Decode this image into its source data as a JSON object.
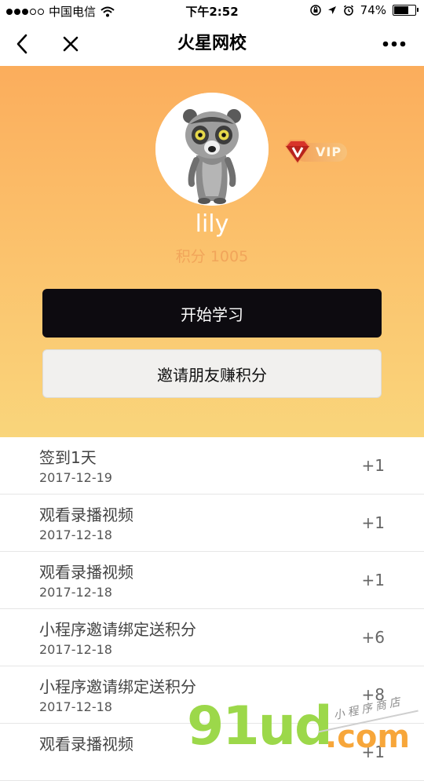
{
  "status_bar": {
    "carrier": "中国电信",
    "time": "下午2:52",
    "battery": "74%",
    "battery_level": 0.74
  },
  "nav": {
    "title": "火星网校"
  },
  "profile": {
    "name": "lily",
    "points": "积分 1005",
    "vip_label": "VIP"
  },
  "buttons": {
    "start": "开始学习",
    "invite": "邀请朋友赚积分"
  },
  "records": [
    {
      "title": "签到1天",
      "date": "2017-12-19",
      "score": "+1"
    },
    {
      "title": "观看录播视频",
      "date": "2017-12-18",
      "score": "+1"
    },
    {
      "title": "观看录播视频",
      "date": "2017-12-18",
      "score": "+1"
    },
    {
      "title": "小程序邀请绑定送积分",
      "date": "2017-12-18",
      "score": "+6"
    },
    {
      "title": "小程序邀请绑定送积分",
      "date": "2017-12-18",
      "score": "+8"
    },
    {
      "title": "观看录播视频",
      "date": "",
      "score": "+1"
    }
  ],
  "watermark": {
    "main": "91ud",
    "suffix": ".com",
    "small": "小程序商店"
  },
  "colors": {
    "hero_top": "#fbad5c",
    "hero_bottom": "#f9d57b",
    "primary_button": "#0d0b10",
    "points_text": "#f1a55a"
  }
}
